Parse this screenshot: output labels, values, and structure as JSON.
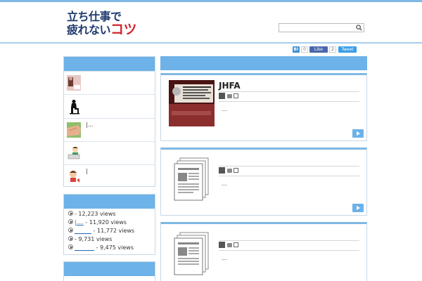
{
  "site": {
    "logo_line1": "立ち仕事で",
    "logo_line2_prefix": "疲れない",
    "logo_line2_accent": "コツ"
  },
  "search": {
    "placeholder": "",
    "icon": "search-icon"
  },
  "social": {
    "hatena_label": "B!",
    "hatena_count": "0",
    "fb_label": "Like",
    "fb_count": "2",
    "tweet_label": "Tweet"
  },
  "sidebar": {
    "recent_items": [
      {
        "text": ""
      },
      {
        "text": ""
      },
      {
        "text": "|..."
      },
      {
        "text": ""
      },
      {
        "text": "|"
      }
    ],
    "ranking": [
      {
        "link": "",
        "views": "- 12,223 views"
      },
      {
        "link": "|....",
        "views": " - 11,920 views"
      },
      {
        "link": "______",
        "views": " - 11,772 views"
      },
      {
        "link": "",
        "views": "- 9,731 views"
      },
      {
        "link": "_______",
        "views": " - 9,475 views"
      }
    ]
  },
  "posts": [
    {
      "title": "JHFA",
      "excerpt": "..."
    },
    {
      "title": "",
      "excerpt": "..."
    },
    {
      "title": "",
      "excerpt": "..."
    }
  ],
  "colors": {
    "accent": "#6db2e8",
    "border": "#c8d7e5",
    "logo_blue": "#1f3b6e",
    "logo_red": "#d0252b"
  }
}
